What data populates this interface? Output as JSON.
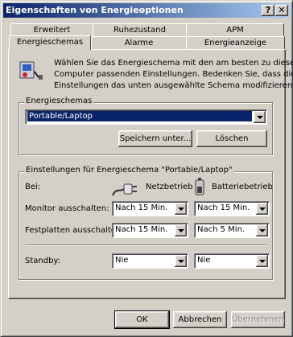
{
  "window": {
    "title": "Eigenschaften von Energieoptionen",
    "help_label": "?",
    "close_label": "✕"
  },
  "tabs": {
    "row_back": [
      "Erweitert",
      "Ruhezustand",
      "APM"
    ],
    "row_front": [
      "Energieschemas",
      "Alarme",
      "Energieanzeige"
    ]
  },
  "intro_text_lines": [
    "Wählen Sie das Energieschema mit den am besten zu diesem",
    "Computer passenden Einstellungen. Bedenken Sie, dass die",
    "Einstellungen das unten ausgewählte Schema modifizieren"
  ],
  "schemes": {
    "group_label": "Energieschemas",
    "selected": "Portable/Laptop",
    "save_label": "Speichern unter...",
    "delete_label": "Löschen"
  },
  "settings": {
    "group_label": "Einstellungen für Energieschema \"Portable/Laptop\"",
    "at_label": "Bei:",
    "ac_label": "Netzbetrieb",
    "battery_label": "Batteriebetrieb",
    "rows": [
      {
        "label": "Monitor ausschalten:",
        "ac": "Nach 15 Min.",
        "battery": "Nach 15 Min."
      },
      {
        "label": "Festplatten ausschalten:",
        "ac": "Nach 15 Min.",
        "battery": "Nach 5 Min."
      },
      {
        "label": "Standby:",
        "ac": "Nie",
        "battery": "Nie"
      }
    ]
  },
  "footer": {
    "ok_label": "OK",
    "cancel_label": "Abbrechen",
    "apply_label": "Übernehmen"
  }
}
